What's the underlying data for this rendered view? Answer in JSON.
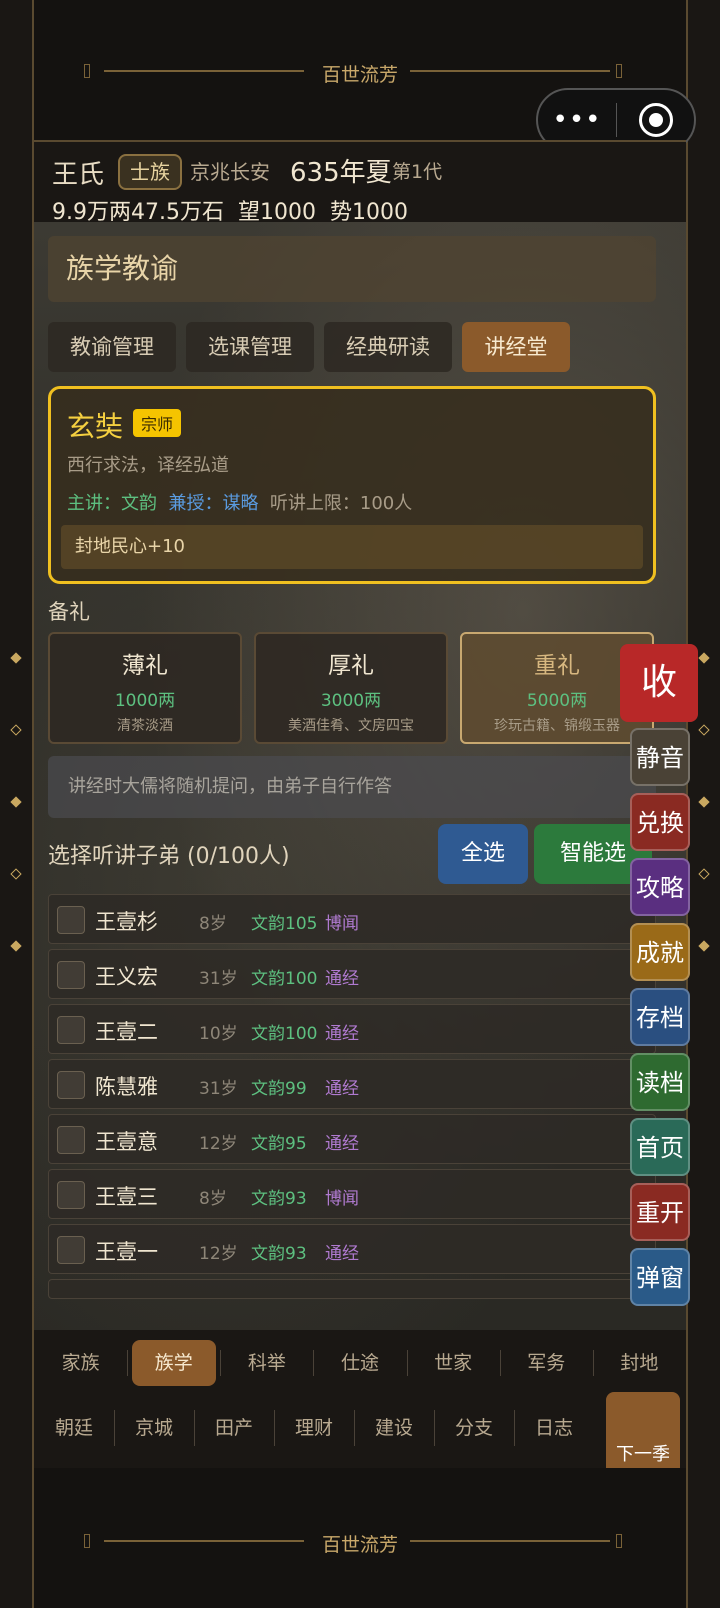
{
  "banner": {
    "title": "百世流芳"
  },
  "capsule": {
    "more_glyph": "•••",
    "close_icon": "target-icon"
  },
  "header": {
    "family_name": "王氏",
    "clan_badge": "士族",
    "location": "京兆长安",
    "year": "635年夏",
    "generation": "第1代",
    "stats": [
      "9.9万两",
      "47.5万石",
      "望1000",
      "势1000"
    ]
  },
  "section": {
    "title": "族学教谕"
  },
  "tabs": [
    {
      "label": "教谕管理"
    },
    {
      "label": "选课管理"
    },
    {
      "label": "经典研读"
    },
    {
      "label": "讲经堂",
      "active": true
    }
  ],
  "teacher": {
    "name": "玄奘",
    "rank": "宗师",
    "motto": "西行求法，译经弘道",
    "main_label": "主讲：",
    "main_value": "文韵",
    "sub_label": "兼授：",
    "sub_value": "谋略",
    "limit": "听讲上限：100人",
    "effect": "封地民心+10"
  },
  "gifts": {
    "label": "备礼",
    "items": [
      {
        "name": "薄礼",
        "price": "1000两",
        "desc": "清茶淡酒"
      },
      {
        "name": "厚礼",
        "price": "3000两",
        "desc": "美酒佳肴、文房四宝"
      },
      {
        "name": "重礼",
        "price": "5000两",
        "desc": "珍玩古籍、锦缎玉器",
        "selected": true
      }
    ]
  },
  "notice": "讲经时大儒将随机提问，由弟子自行作答",
  "selection": {
    "title": "选择听讲子弟 (0/100人)",
    "select_all": "全选",
    "smart_select": "智能选"
  },
  "students": [
    {
      "name": "王壹杉",
      "age": "8岁",
      "skill": "文韵105",
      "trait": "博闻"
    },
    {
      "name": "王义宏",
      "age": "31岁",
      "skill": "文韵100",
      "trait": "通经"
    },
    {
      "name": "王壹二",
      "age": "10岁",
      "skill": "文韵100",
      "trait": "通经"
    },
    {
      "name": "陈慧雅",
      "age": "31岁",
      "skill": "文韵99",
      "trait": "通经"
    },
    {
      "name": "王壹意",
      "age": "12岁",
      "skill": "文韵95",
      "trait": "通经"
    },
    {
      "name": "王壹三",
      "age": "8岁",
      "skill": "文韵93",
      "trait": "博闻"
    },
    {
      "name": "王壹一",
      "age": "12岁",
      "skill": "文韵93",
      "trait": "通经"
    }
  ],
  "side_menu": {
    "collapse": "收",
    "items": [
      {
        "label": "静音",
        "color": "#4a4236"
      },
      {
        "label": "兑换",
        "color": "#8a2a22"
      },
      {
        "label": "攻略",
        "color": "#5a2f80"
      },
      {
        "label": "成就",
        "color": "#9a6a18"
      },
      {
        "label": "存档",
        "color": "#2a4f80"
      },
      {
        "label": "读档",
        "color": "#2e6a30"
      },
      {
        "label": "首页",
        "color": "#2a6a58"
      },
      {
        "label": "重开",
        "color": "#8a2a22"
      },
      {
        "label": "弹窗",
        "color": "#2a5a88"
      }
    ]
  },
  "nav_primary": [
    {
      "label": "家族"
    },
    {
      "label": "族学",
      "active": true
    },
    {
      "label": "科举"
    },
    {
      "label": "仕途"
    },
    {
      "label": "世家"
    },
    {
      "label": "军务"
    },
    {
      "label": "封地"
    }
  ],
  "nav_secondary": [
    {
      "label": "朝廷"
    },
    {
      "label": "京城"
    },
    {
      "label": "田产"
    },
    {
      "label": "理财"
    },
    {
      "label": "建设"
    },
    {
      "label": "分支"
    },
    {
      "label": "日志"
    }
  ],
  "next_season": "下一季"
}
